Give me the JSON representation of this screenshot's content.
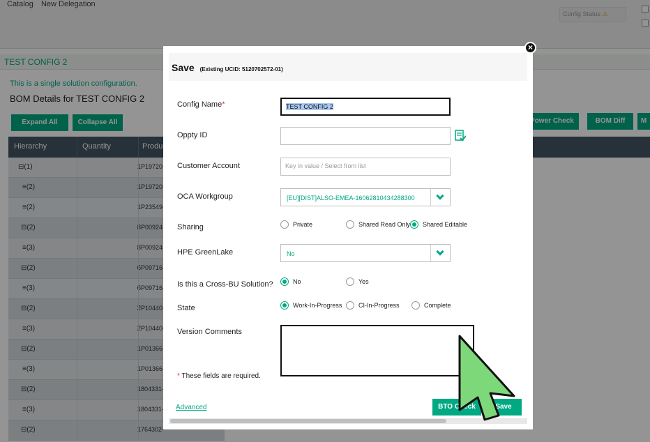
{
  "topbar": {
    "crumb_catalog": "Catalog",
    "crumb_new_delegation": "New Delegation",
    "config_status": "Config Status"
  },
  "config_title": "TEST CONFIG 2",
  "single_solution_text": "This is a single solution configuration.",
  "bom_title": "BOM Details for TEST CONFIG 2",
  "toolbar": {
    "expand_all": "Expand All",
    "collapse_all": "Collapse All",
    "power_check": "d Power Check",
    "bom_diff": "BOM Diff",
    "more": "M"
  },
  "table": {
    "headers": [
      "Hierarchy",
      "Quantity",
      "Produc"
    ],
    "rows": [
      {
        "tree": "(1)",
        "qty": "1",
        "prod": "P19720-",
        "type": "expand"
      },
      {
        "tree": "(2)",
        "qty": "1",
        "prod": "P19720-",
        "type": "list"
      },
      {
        "tree": "(2)",
        "qty": "1",
        "prod": "P23549-",
        "type": "list"
      },
      {
        "tree": "(2)",
        "qty": "8",
        "prod": "P00924-",
        "type": "expand"
      },
      {
        "tree": "(3)",
        "qty": "8",
        "prod": "P00924-",
        "type": "list"
      },
      {
        "tree": "(2)",
        "qty": "6",
        "prod": "P09716-",
        "type": "expand"
      },
      {
        "tree": "(3)",
        "qty": "6",
        "prod": "P09716-",
        "type": "list"
      },
      {
        "tree": "(2)",
        "qty": "2",
        "prod": "P10440-",
        "type": "expand"
      },
      {
        "tree": "(3)",
        "qty": "2",
        "prod": "P10440-",
        "type": "list"
      },
      {
        "tree": "(2)",
        "qty": "1",
        "prod": "P01366-",
        "type": "expand"
      },
      {
        "tree": "(3)",
        "qty": "1",
        "prod": "P01366-",
        "type": "list"
      },
      {
        "tree": "(2)",
        "qty": "1",
        "prod": "804331-",
        "type": "expand"
      },
      {
        "tree": "(3)",
        "qty": "1",
        "prod": "804331-",
        "type": "list"
      },
      {
        "tree": "(2)",
        "qty": "1",
        "prod": "764302-",
        "type": "expand"
      }
    ]
  },
  "modal": {
    "title": "Save",
    "subtitle": "(Existing UCID: 5120702572-01)",
    "fields": {
      "config_name_label": "Config Name",
      "config_name_value": "TEST CONFIG 2",
      "oppty_id_label": "Oppty ID",
      "oppty_id_value": "",
      "customer_account_label": "Customer Account",
      "customer_account_placeholder": "Key in value / Select from list",
      "oca_workgroup_label": "OCA Workgroup",
      "oca_workgroup_value": "[EU][DIST]ALSO-EMEA-16062810434288300",
      "sharing_label": "Sharing",
      "sharing_options": [
        "Private",
        "Shared Read Only",
        "Shared Editable"
      ],
      "sharing_selected": "Shared Editable",
      "greenlake_label": "HPE GreenLake",
      "greenlake_value": "No",
      "cross_bu_label": "Is this a Cross-BU Solution?",
      "cross_bu_options": [
        "No",
        "Yes"
      ],
      "cross_bu_selected": "No",
      "state_label": "State",
      "state_options": [
        "Work-In-Progress",
        "CI-In-Progress",
        "Complete"
      ],
      "state_selected": "Work-In-Progress",
      "version_comments_label": "Version Comments",
      "version_comments_value": ""
    },
    "required_note": "These fields are required.",
    "advanced_link": "Advanced",
    "bto_check_label": "BTO Check",
    "save_label": "Save"
  },
  "colors": {
    "accent": "#01a982",
    "header_dark": "#425563",
    "required": "#e0322c",
    "cursor": "#7dd87a"
  }
}
